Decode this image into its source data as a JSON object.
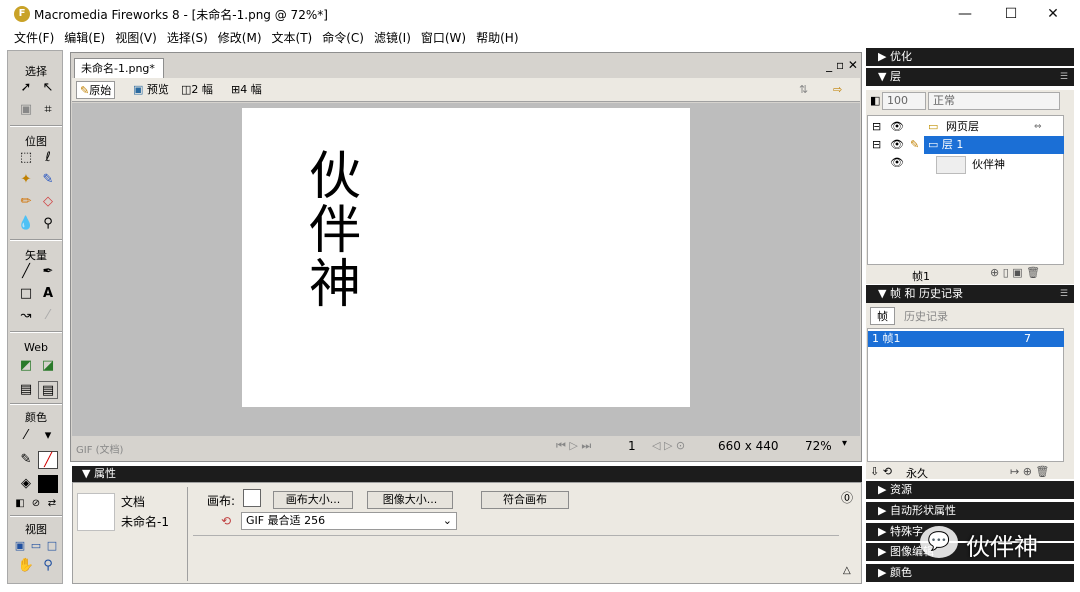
{
  "window": {
    "title": "Macromedia Fireworks 8 - [未命名-1.png @  72%*]",
    "app_icon": "fireworks-logo",
    "min": "—",
    "max": "☐",
    "close": "✕"
  },
  "menu": [
    "文件(F)",
    "编辑(E)",
    "视图(V)",
    "选择(S)",
    "修改(M)",
    "文本(T)",
    "命令(C)",
    "滤镜(I)",
    "窗口(W)",
    "帮助(H)"
  ],
  "tools": {
    "select": "选择",
    "bitmap": "位图",
    "vector": "矢量",
    "web": "Web",
    "color": "颜色",
    "view": "视图"
  },
  "document": {
    "tab": "未命名-1.png*",
    "tab_controls": "_ ▫ ✕",
    "views": {
      "original": "原始",
      "preview": "预览",
      "two_up": "2 幅",
      "four_up": "4 幅"
    },
    "canvas_text": "伙伴神",
    "status_format": "GIF (文档)",
    "frame_number": "1",
    "canvas_size": "660 x 440",
    "zoom": "72%"
  },
  "properties": {
    "header": "▼ 属性",
    "doc_label": "文档",
    "doc_name": "未命名-1",
    "canvas_label": "画布:",
    "canvas_size_btn": "画布大小...",
    "image_size_btn": "图像大小...",
    "fit_canvas_btn": "符合画布",
    "optimize_value": "GIF 最合适 256"
  },
  "panels": {
    "optimize": "▶ 优化",
    "layers": "▼ 层",
    "opacity": "100",
    "blend": "正常",
    "layer_rows": [
      {
        "name": "网页层"
      },
      {
        "name": "层 1"
      },
      {
        "name": "伙伴神"
      }
    ],
    "frame_label": "帧1",
    "frames_history": "▼ 帧 和 历史记录",
    "tab_frames": "帧",
    "tab_history": "历史记录",
    "frame_row": "1  帧1",
    "frame_delay": "7",
    "loop": "永久",
    "assets": "▶ 资源",
    "auto_shape": "▶ 自动形状属性",
    "special_chars": "▶ 特殊字",
    "image_edit": "▶ 图像编辑",
    "colors": "▶ 颜色"
  },
  "watermark": "伙伴神",
  "colors": {
    "selected_layer": "#1b6fd6",
    "panel_head": "#1c1c1c"
  }
}
